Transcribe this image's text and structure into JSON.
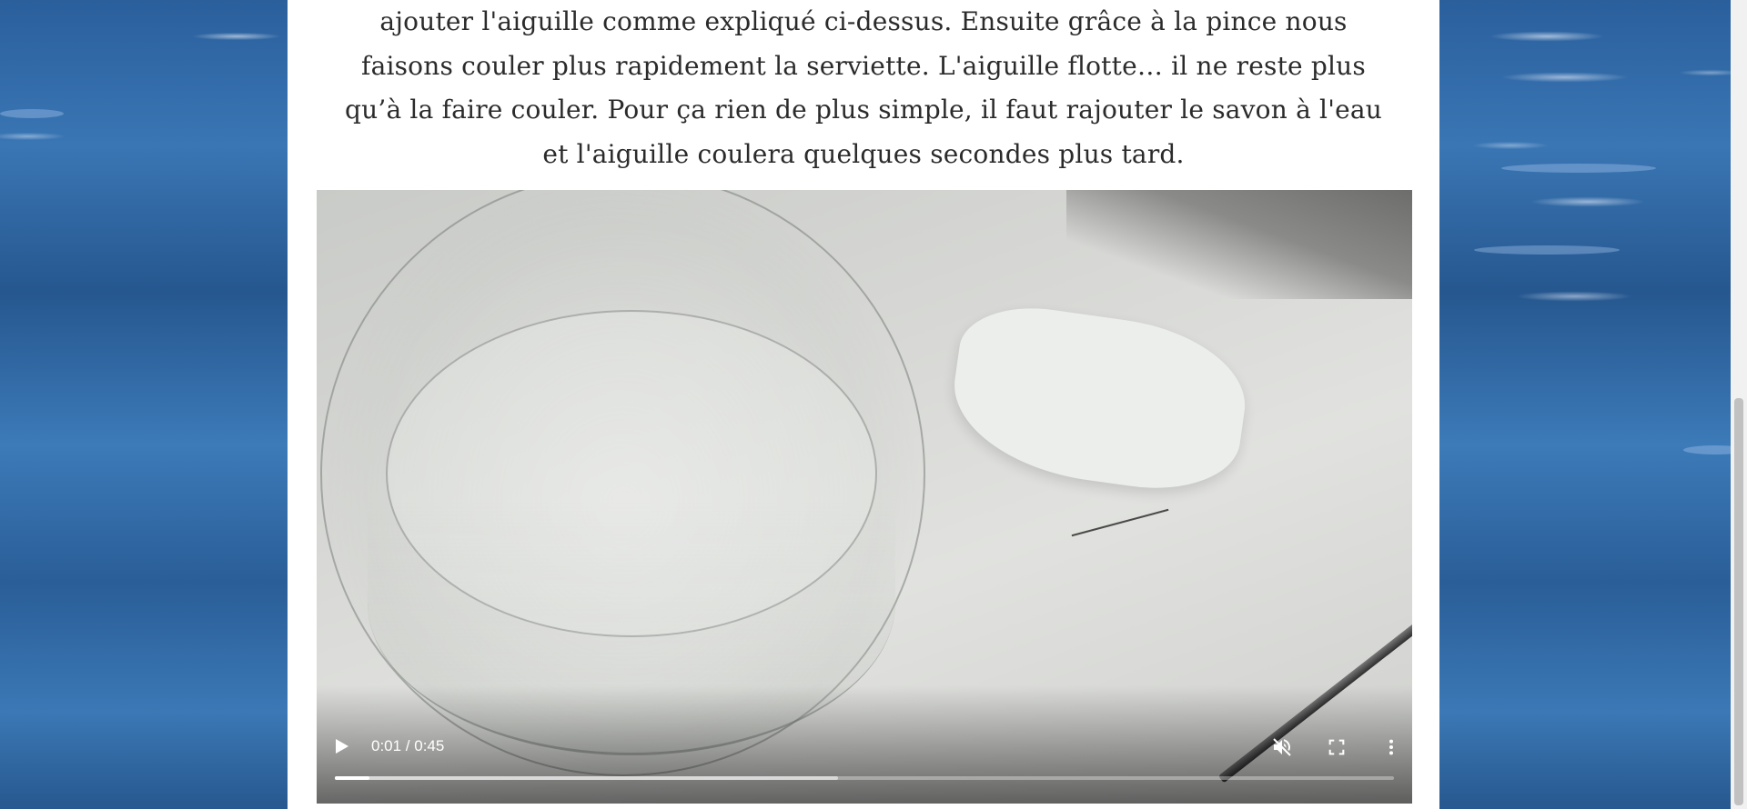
{
  "article": {
    "paragraph_lines": [
      "ajouter l'aiguille comme expliqué ci-dessus. Ensuite grâce à la pince nous",
      "faisons couler plus rapidement la serviette. L'aiguille flotte… il ne reste plus",
      "qu’à la faire couler. Pour ça rien de plus simple, il faut rajouter le savon à l'eau",
      "et l'aiguille coulera quelques secondes plus tard."
    ]
  },
  "video": {
    "time_display": "0:01 / 0:45",
    "played_fraction": 0.033,
    "buffered_fraction": 0.475,
    "icons": {
      "play": "play-icon",
      "mute": "volume-muted-icon",
      "fullscreen": "fullscreen-icon",
      "more": "more-vert-icon"
    }
  },
  "colors": {
    "page_bg": "#ffffff",
    "text": "#2b2b2b",
    "background_water": "#2d5e97"
  }
}
